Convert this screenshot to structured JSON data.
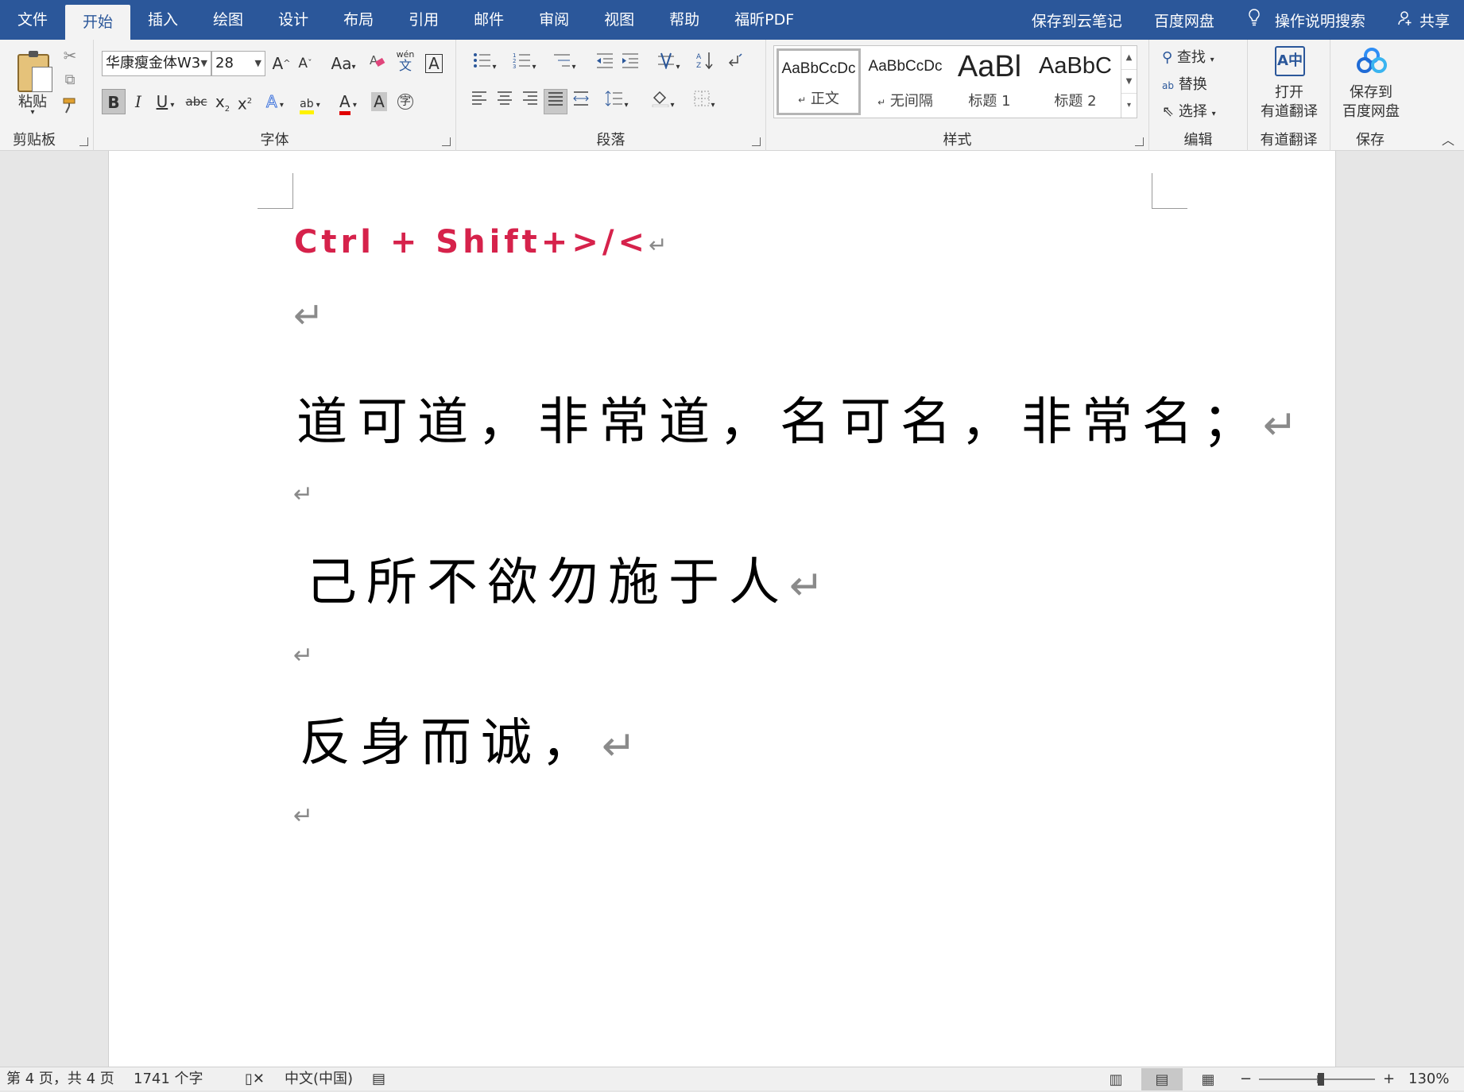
{
  "tabs": [
    {
      "label": "文件",
      "active": false
    },
    {
      "label": "开始",
      "active": true
    },
    {
      "label": "插入",
      "active": false
    },
    {
      "label": "绘图",
      "active": false
    },
    {
      "label": "设计",
      "active": false
    },
    {
      "label": "布局",
      "active": false
    },
    {
      "label": "引用",
      "active": false
    },
    {
      "label": "邮件",
      "active": false
    },
    {
      "label": "审阅",
      "active": false
    },
    {
      "label": "视图",
      "active": false
    },
    {
      "label": "帮助",
      "active": false
    },
    {
      "label": "福昕PDF",
      "active": false
    }
  ],
  "topbar": {
    "save_cloud_note": "保存到云笔记",
    "baidu_disk": "百度网盘",
    "tell_me": "操作说明搜索",
    "share": "共享"
  },
  "ribbon": {
    "clipboard": {
      "paste_label": "粘贴",
      "group_label": "剪贴板"
    },
    "font": {
      "font_name": "华康瘦金体W3",
      "font_size": "28",
      "grow": "A",
      "shrink": "A",
      "change_case": "Aa",
      "phonetic_top": "wén",
      "phonetic_bottom": "文",
      "char_border": "A",
      "bold": "B",
      "italic": "I",
      "underline": "U",
      "strike": "abc",
      "subscript": "x",
      "superscript": "x",
      "text_effects": "A",
      "highlight": "ab",
      "font_color": "A",
      "char_shading": "A",
      "enclose": "字",
      "group_label": "字体"
    },
    "paragraph": {
      "group_label": "段落"
    },
    "styles": {
      "items": [
        {
          "sample": "AaBbCcDc",
          "name": "正文",
          "prefix": "↵"
        },
        {
          "sample": "AaBbCcDc",
          "name": "无间隔",
          "prefix": "↵"
        },
        {
          "sample": "AaBl",
          "name": "标题 1",
          "prefix": ""
        },
        {
          "sample": "AaBbC",
          "name": "标题 2",
          "prefix": ""
        }
      ],
      "group_label": "样式"
    },
    "editing": {
      "find": "查找",
      "replace": "替换",
      "select": "选择",
      "group_label": "编辑"
    },
    "youdao": {
      "open_line1": "打开",
      "open_line2": "有道翻译",
      "group_label": "有道翻译"
    },
    "baidu": {
      "save_line1": "保存到",
      "save_line2": "百度网盘",
      "group_label": "保存"
    }
  },
  "document": {
    "lines": [
      {
        "text": "Ctrl + Shift+>/<",
        "mark": "↵"
      },
      {
        "text": "",
        "mark": "↵"
      },
      {
        "text": "道可道，非常道，名可名，非常名；",
        "mark": "↵"
      },
      {
        "text": "",
        "mark": "↵"
      },
      {
        "text": "己所不欲勿施于人",
        "mark": "↵"
      },
      {
        "text": "",
        "mark": "↵"
      },
      {
        "text": "反身而诚，",
        "mark": "↵"
      },
      {
        "text": "",
        "mark": "↵"
      }
    ]
  },
  "status": {
    "page": "第 4 页，共 4 页",
    "words": "1741 个字",
    "language": "中文(中国)",
    "zoom_minus": "−",
    "zoom_plus": "+",
    "zoom": "130%",
    "zoom_level": 130
  }
}
